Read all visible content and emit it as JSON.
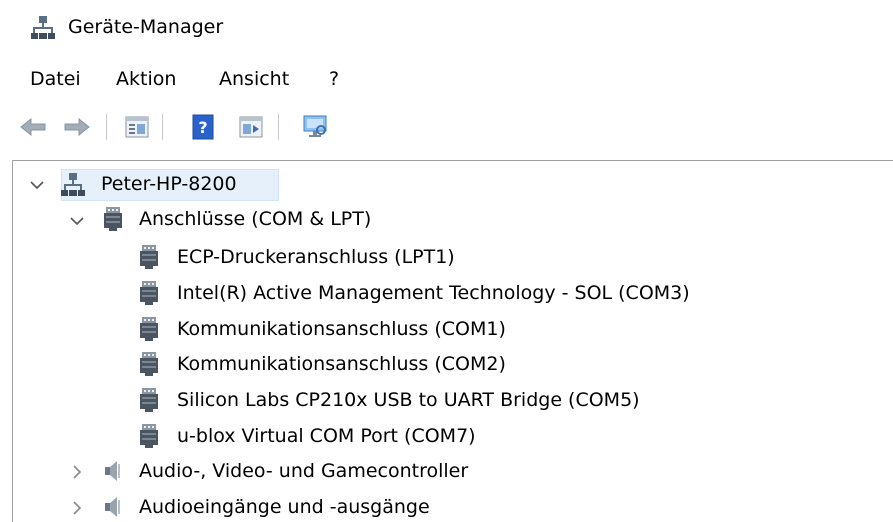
{
  "window": {
    "title": "Geräte-Manager",
    "title_icon": "device-manager-icon"
  },
  "menu": {
    "items": [
      {
        "label": "Datei"
      },
      {
        "label": "Aktion"
      },
      {
        "label": "Ansicht"
      },
      {
        "label": "?"
      }
    ]
  },
  "toolbar": {
    "buttons": [
      {
        "icon": "back-arrow-icon"
      },
      {
        "icon": "forward-arrow-icon"
      },
      {
        "icon": "properties-icon"
      },
      {
        "icon": "help-icon"
      },
      {
        "icon": "update-driver-icon"
      },
      {
        "icon": "scan-hardware-icon"
      }
    ]
  },
  "tree": {
    "root": {
      "label": "Peter-HP-8200",
      "expanded": true,
      "icon": "computer-icon"
    },
    "categories": [
      {
        "label": "Anschlüsse (COM & LPT)",
        "expanded": true,
        "icon": "port-icon",
        "children": [
          {
            "label": "ECP-Druckeranschluss (LPT1)",
            "icon": "port-icon"
          },
          {
            "label": "Intel(R) Active Management Technology - SOL (COM3)",
            "icon": "port-icon"
          },
          {
            "label": "Kommunikationsanschluss (COM1)",
            "icon": "port-icon"
          },
          {
            "label": "Kommunikationsanschluss (COM2)",
            "icon": "port-icon"
          },
          {
            "label": "Silicon Labs CP210x USB to UART Bridge (COM5)",
            "icon": "port-icon"
          },
          {
            "label": "u-blox Virtual COM Port (COM7)",
            "icon": "port-icon"
          }
        ]
      },
      {
        "label": "Audio-, Video- und Gamecontroller",
        "expanded": false,
        "icon": "speaker-icon"
      },
      {
        "label": "Audioeingänge und -ausgänge",
        "expanded": false,
        "icon": "speaker-icon"
      }
    ]
  },
  "colors": {
    "selection": "#e5f0fb",
    "toolbar_blue": "#2a62c9",
    "gray_arrow": "#9aa3ad"
  }
}
